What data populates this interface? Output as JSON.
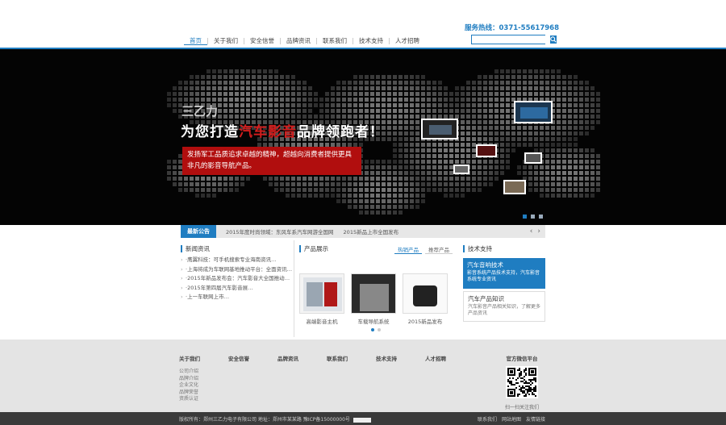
{
  "header": {
    "hotline": "服务热线：0371-55617968",
    "search_placeholder": "",
    "nav": [
      "首页",
      "关于我们",
      "安全信誉",
      "品牌资讯",
      "联系我们",
      "技术支持",
      "人才招聘"
    ]
  },
  "banner": {
    "slogan_top": "三乙力",
    "slogan_pre": "为您打造",
    "slogan_highlight": "汽车影音",
    "slogan_post": "品牌领跑者！",
    "slogan_box": "发扬军工品质追求卓越的精神，超越向消费者提供更具非凡的影音导航产品。"
  },
  "ticker": {
    "label": "最新公告",
    "items": [
      "2015年度时尚领域：东风车系汽车网游全国网",
      "2015新品上市全国发布"
    ]
  },
  "news": {
    "title": "新闻资讯",
    "items": [
      "·鹰翼科技：可手机搜索专业海南资讯…",
      "·上海将成为车联网基地推动平台：全面资讯…",
      "·2015年新品发布会：汽车影音大全国推动…",
      "·2015年第四届汽车影音展…",
      "·上一车联网上市…"
    ]
  },
  "products": {
    "title": "产品展示",
    "tabs": [
      "热销产品",
      "推荐产品"
    ],
    "items": [
      {
        "caption": "高端影音主机"
      },
      {
        "caption": "车载导航系统"
      },
      {
        "caption": "2015新品发布"
      }
    ]
  },
  "tech": {
    "title": "技术支持",
    "cards": [
      {
        "head": "汽车音响技术",
        "body": "影音系统产品技术支持，汽车影音系统专业资讯"
      },
      {
        "head": "汽车产品知识",
        "body": "汽车影音产品相关知识，了解更多产品资讯"
      }
    ]
  },
  "footer": {
    "cols": [
      {
        "title": "关于我们",
        "items": [
          "公司介绍",
          "品牌介绍",
          "企业文化",
          "品牌荣誉",
          "资质认证"
        ]
      },
      {
        "title": "安全信誉",
        "items": []
      },
      {
        "title": "品牌资讯",
        "items": []
      },
      {
        "title": "联系我们",
        "items": []
      },
      {
        "title": "技术支持",
        "items": []
      },
      {
        "title": "人才招聘",
        "items": []
      }
    ],
    "wechat_title": "官方微信平台",
    "wechat_caption": "扫一扫关注我们"
  },
  "bottom": {
    "copyright": "版权所有：郑州三乙力电子有限公司  地址：郑州市某某路  豫ICP备15000000号",
    "links": [
      "联系我们",
      "网站地图",
      "友情链接"
    ]
  }
}
